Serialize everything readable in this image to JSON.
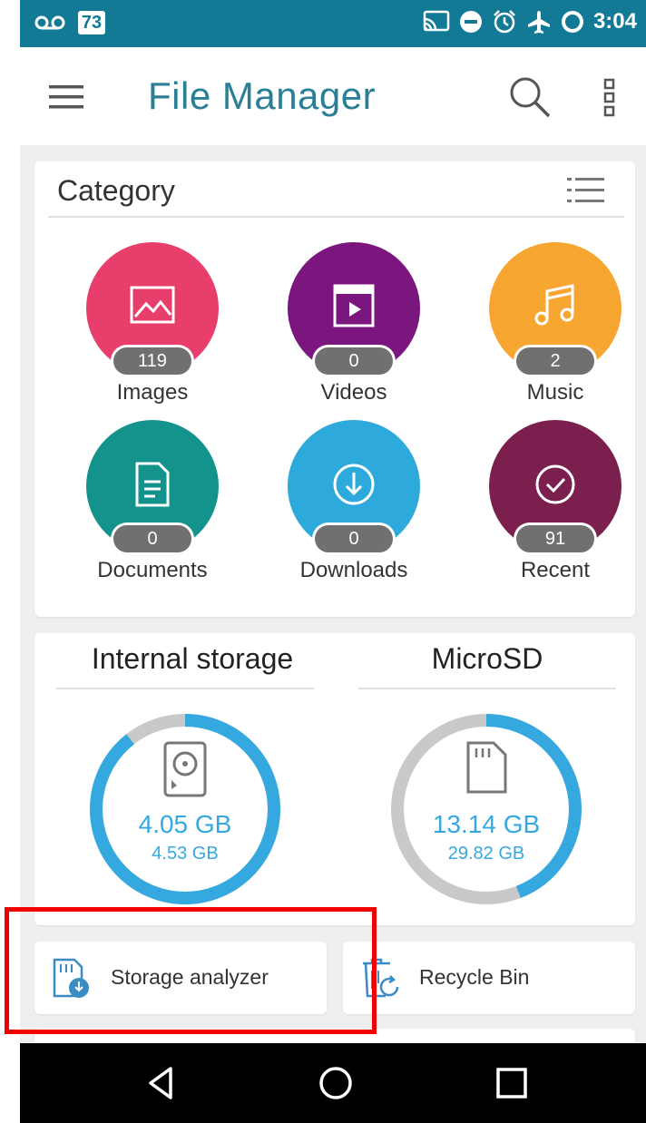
{
  "status_bar": {
    "time": "3:04",
    "notification_count": "73",
    "left_icons": [
      "voicemail-icon",
      "notification-badge"
    ],
    "right_icons": [
      "cast-icon",
      "do-not-disturb-icon",
      "alarm-icon",
      "airplane-mode-icon",
      "battery-icon"
    ]
  },
  "app_bar": {
    "title": "File Manager",
    "menu_icon": "menu-icon",
    "search_icon": "search-icon",
    "more_icon": "more-vert-icon"
  },
  "category": {
    "title": "Category",
    "view_toggle_icon": "list-view-icon",
    "items": [
      {
        "label": "Images",
        "count": "119",
        "color": "#e83e6c",
        "icon": "image-icon"
      },
      {
        "label": "Videos",
        "count": "0",
        "color": "#7a167d",
        "icon": "video-icon"
      },
      {
        "label": "Music",
        "count": "2",
        "color": "#f8a632",
        "icon": "music-icon"
      },
      {
        "label": "Documents",
        "count": "0",
        "color": "#13938b",
        "icon": "document-icon"
      },
      {
        "label": "Downloads",
        "count": "0",
        "color": "#2ea9dc",
        "icon": "download-icon"
      },
      {
        "label": "Recent",
        "count": "91",
        "color": "#7b1f4f",
        "icon": "check-circle-icon"
      }
    ]
  },
  "storage": {
    "internal": {
      "title": "Internal storage",
      "used": "4.05 GB",
      "total": "4.53 GB",
      "icon": "hard-drive-icon",
      "used_fraction": 0.894
    },
    "microsd": {
      "title": "MicroSD",
      "used": "13.14 GB",
      "total": "29.82 GB",
      "icon": "sd-card-icon",
      "used_fraction": 0.441
    }
  },
  "tools": {
    "storage_analyzer": {
      "label": "Storage analyzer",
      "icon": "storage-analyzer-icon"
    },
    "recycle_bin": {
      "label": "Recycle Bin",
      "icon": "recycle-bin-icon"
    }
  },
  "nav": {
    "back_icon": "back-icon",
    "home_icon": "home-icon",
    "recents_icon": "recents-icon"
  },
  "colors": {
    "status_bar": "#127a94",
    "title": "#2a7f97",
    "ring_used": "#35a9df",
    "ring_track": "#c9c9c9",
    "highlight": "#f20000"
  }
}
